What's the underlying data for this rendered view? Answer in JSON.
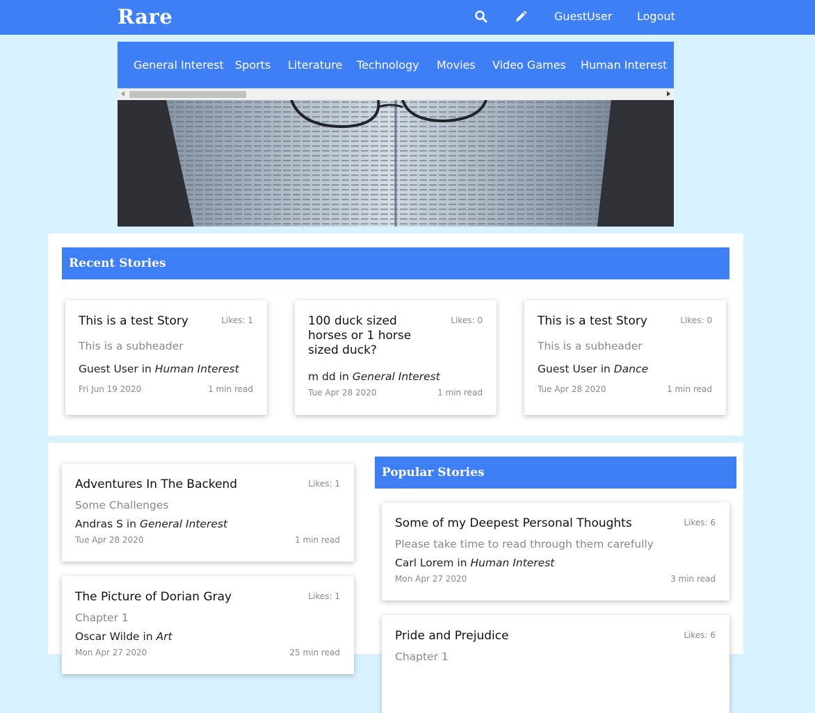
{
  "header": {
    "logo": "Rare",
    "user_label": "GuestUser",
    "logout_label": "Logout",
    "search_icon": "search-icon",
    "write_icon": "pencil-icon",
    "color": "#3f7ff5"
  },
  "categories": [
    "General Interest",
    "Sports",
    "Literature",
    "Technology",
    "Movies",
    "Video Games",
    "Human Interest"
  ],
  "recent": {
    "title": "Recent Stories",
    "stories": [
      {
        "title": "This is a test Story",
        "likes": "Likes: 1",
        "subheader": "This is a subheader",
        "author": "Guest User",
        "in": "in",
        "category": "Human Interest",
        "date": "Fri Jun 19 2020",
        "read": "1 min read"
      },
      {
        "title": "100 duck sized horses or 1 horse sized duck?",
        "likes": "Likes: 0",
        "subheader": "",
        "author": "m dd",
        "in": "in",
        "category": "General Interest",
        "date": "Tue Apr 28 2020",
        "read": "1 min read"
      },
      {
        "title": "This is a test Story",
        "likes": "Likes: 0",
        "subheader": "This is a subheader",
        "author": "Guest User",
        "in": "in",
        "category": "Dance",
        "date": "Tue Apr 28 2020",
        "read": "1 min read"
      }
    ]
  },
  "feed": {
    "stories": [
      {
        "title": "Adventures In The Backend",
        "likes": "Likes: 1",
        "subheader": "Some Challenges",
        "author": "Andras S",
        "in": "in",
        "category": "General Interest",
        "date": "Tue Apr 28 2020",
        "read": "1 min read"
      },
      {
        "title": "The Picture of Dorian Gray",
        "likes": "Likes: 1",
        "subheader": "Chapter 1",
        "author": "Oscar Wilde",
        "in": "in",
        "category": "Art",
        "date": "Mon Apr 27 2020",
        "read": "25 min read"
      }
    ]
  },
  "popular": {
    "title": "Popular Stories",
    "stories": [
      {
        "title": "Some of my Deepest Personal Thoughts",
        "likes": "Likes: 6",
        "subheader": "Please take time to read through them carefully",
        "author": "Carl Lorem",
        "in": "in",
        "category": "Human Interest",
        "date": "Mon Apr 27 2020",
        "read": "3 min read"
      },
      {
        "title": "Pride and Prejudice",
        "likes": "Likes: 6",
        "subheader": "Chapter 1",
        "author": "",
        "in": "",
        "category": "",
        "date": "",
        "read": ""
      }
    ]
  }
}
